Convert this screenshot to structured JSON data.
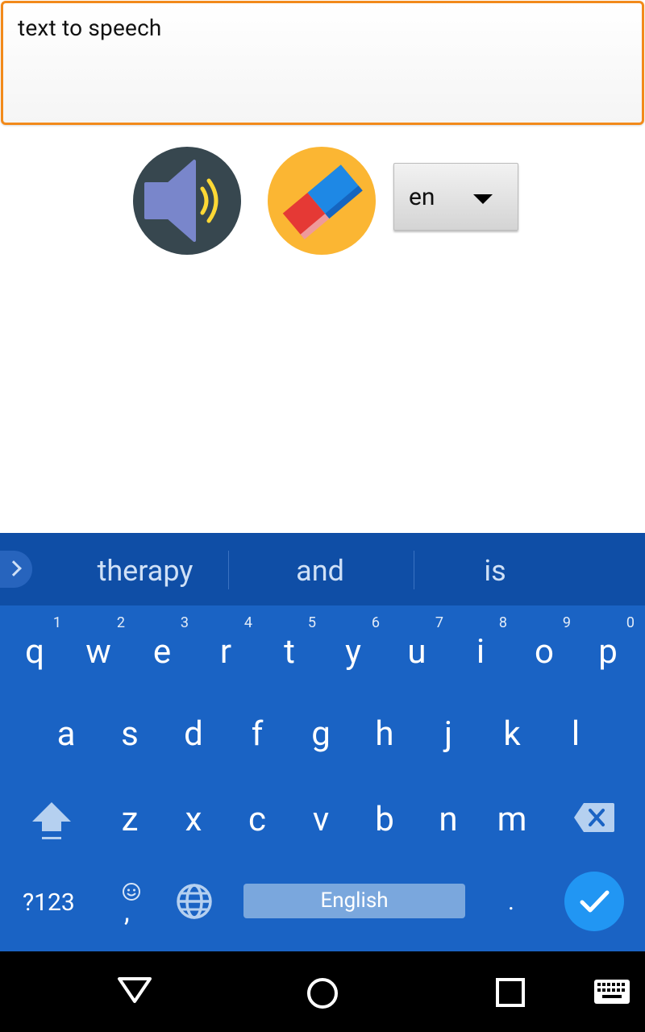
{
  "input": {
    "value": "text to speech"
  },
  "actions": {
    "speak_icon": "speaker-icon",
    "clear_icon": "eraser-icon"
  },
  "language_select": {
    "selected": "en"
  },
  "keyboard": {
    "suggestions": [
      "therapy",
      "and",
      "is"
    ],
    "row1": [
      {
        "letter": "q",
        "hint": "1"
      },
      {
        "letter": "w",
        "hint": "2"
      },
      {
        "letter": "e",
        "hint": "3"
      },
      {
        "letter": "r",
        "hint": "4"
      },
      {
        "letter": "t",
        "hint": "5"
      },
      {
        "letter": "y",
        "hint": "6"
      },
      {
        "letter": "u",
        "hint": "7"
      },
      {
        "letter": "i",
        "hint": "8"
      },
      {
        "letter": "o",
        "hint": "9"
      },
      {
        "letter": "p",
        "hint": "0"
      }
    ],
    "row2": [
      "a",
      "s",
      "d",
      "f",
      "g",
      "h",
      "j",
      "k",
      "l"
    ],
    "row3": [
      "z",
      "x",
      "c",
      "v",
      "b",
      "n",
      "m"
    ],
    "symbols_label": "?123",
    "comma_label": ",",
    "space_label": "English",
    "period_label": ".",
    "colors": {
      "background": "#1a63c4",
      "suggestion_bar": "#0f4ea6",
      "enter": "#2196f3",
      "space": "#7aa7dd"
    }
  },
  "colors": {
    "input_border": "#f28a1b",
    "speak_bg": "#37474f",
    "clear_bg": "#fbb633"
  }
}
